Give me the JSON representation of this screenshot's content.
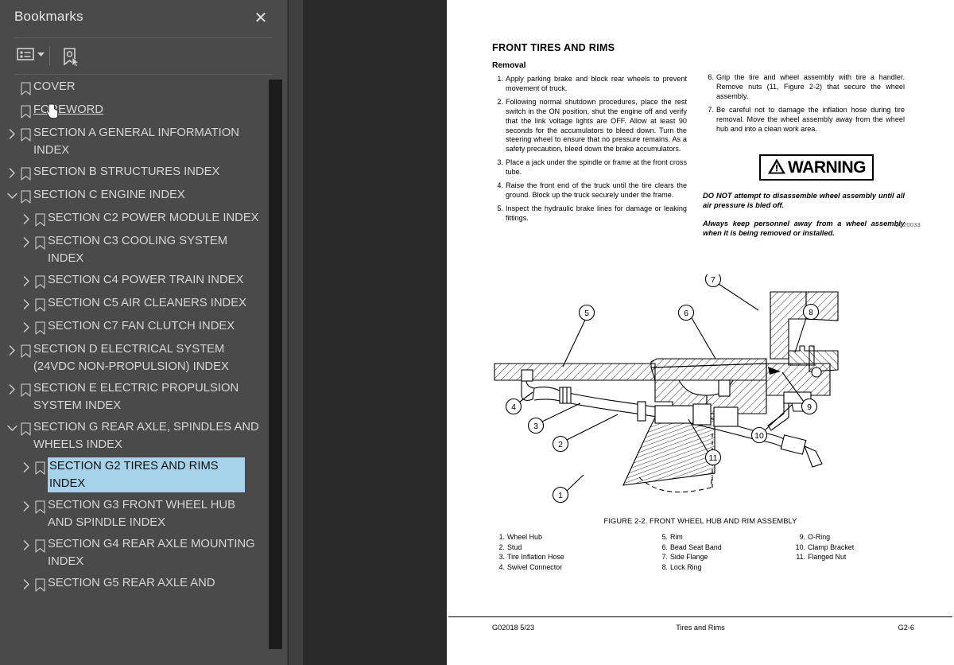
{
  "panel": {
    "title": "Bookmarks",
    "close_icon": "close-icon",
    "toolbar": {
      "options_icon": "list-options-icon",
      "options_caret_icon": "chevron-down-icon",
      "add_bookmark_icon": "add-bookmark-icon"
    },
    "items": [
      {
        "label": "COVER",
        "level": 0,
        "state": "leaf",
        "selected": false,
        "hovered": false
      },
      {
        "label": "FOREWORD",
        "level": 0,
        "state": "leaf",
        "selected": false,
        "hovered": true
      },
      {
        "label": "SECTION A GENERAL INFORMATION INDEX",
        "level": 0,
        "state": "collapsed",
        "selected": false,
        "hovered": false
      },
      {
        "label": "SECTION B STRUCTURES INDEX",
        "level": 0,
        "state": "collapsed",
        "selected": false,
        "hovered": false
      },
      {
        "label": "SECTION C ENGINE INDEX",
        "level": 0,
        "state": "expanded",
        "selected": false,
        "hovered": false
      },
      {
        "label": "SECTION C2 POWER MODULE INDEX",
        "level": 1,
        "state": "collapsed",
        "selected": false,
        "hovered": false
      },
      {
        "label": "SECTION C3 COOLING SYSTEM INDEX",
        "level": 1,
        "state": "collapsed",
        "selected": false,
        "hovered": false
      },
      {
        "label": "SECTION C4 POWER TRAIN INDEX",
        "level": 1,
        "state": "collapsed",
        "selected": false,
        "hovered": false
      },
      {
        "label": "SECTION C5 AIR CLEANERS INDEX",
        "level": 1,
        "state": "collapsed",
        "selected": false,
        "hovered": false
      },
      {
        "label": "SECTION C7 FAN CLUTCH INDEX",
        "level": 1,
        "state": "collapsed",
        "selected": false,
        "hovered": false
      },
      {
        "label": "SECTION D ELECTRICAL SYSTEM (24VDC NON-PROPULSION) INDEX",
        "level": 0,
        "state": "collapsed",
        "selected": false,
        "hovered": false
      },
      {
        "label": "SECTION E ELECTRIC PROPULSION SYSTEM INDEX",
        "level": 0,
        "state": "collapsed",
        "selected": false,
        "hovered": false
      },
      {
        "label": "SECTION G REAR AXLE, SPINDLES AND WHEELS INDEX",
        "level": 0,
        "state": "expanded",
        "selected": false,
        "hovered": false
      },
      {
        "label": "SECTION G2 TIRES AND RIMS INDEX",
        "level": 1,
        "state": "collapsed",
        "selected": true,
        "hovered": false
      },
      {
        "label": "SECTION G3 FRONT WHEEL HUB AND SPINDLE INDEX",
        "level": 1,
        "state": "collapsed",
        "selected": false,
        "hovered": false
      },
      {
        "label": "SECTION G4 REAR AXLE MOUNTING INDEX",
        "level": 1,
        "state": "collapsed",
        "selected": false,
        "hovered": false
      },
      {
        "label": "SECTION G5 REAR AXLE AND",
        "level": 1,
        "state": "collapsed",
        "selected": false,
        "hovered": false
      }
    ],
    "collapse_handle_icon": "collapse-panel-arrow-icon"
  },
  "document": {
    "title": "FRONT TIRES AND RIMS",
    "subtitle": "Removal",
    "steps_left": [
      {
        "n": "1.",
        "text": "Apply parking brake and block rear wheels to prevent movement of truck."
      },
      {
        "n": "2.",
        "text": "Following normal shutdown procedures, place the rest switch in the ON position, shut the engine off and verify that the link voltage lights are OFF. Allow at least 90 seconds for the accumulators to bleed down. Turn the steering wheel to ensure that no pressure remains. As a safety precaution, bleed down the brake accumulators."
      },
      {
        "n": "3.",
        "text": "Place a jack under the spindle or frame at the front cross tube."
      },
      {
        "n": "4.",
        "text": "Raise the front end of the truck until the tire clears the ground. Block up the truck securely under the frame."
      },
      {
        "n": "5.",
        "text": "Inspect the hydraulic brake lines for damage or leaking fittings."
      }
    ],
    "steps_right": [
      {
        "n": "6.",
        "text": "Grip the tire and wheel assembly with tire a handler. Remove nuts (11, Figure 2-2) that secure the wheel assembly."
      },
      {
        "n": "7.",
        "text": "Be careful not to damage the inflation hose during tire removal. Move the wheel assembly away from the wheel hub and into a clean work area."
      }
    ],
    "warning": {
      "icon": "warning-triangle-icon",
      "label": "WARNING",
      "paragraphs": [
        "DO NOT attempt to disassemble wheel assembly until all air pressure is bled off.",
        "Always keep personnel away from a wheel assembly when it is being removed or installed."
      ]
    },
    "figure": {
      "drawing_number": "G020033",
      "caption": "FIGURE 2-2. FRONT WHEEL HUB AND RIM ASSEMBLY",
      "callouts": [
        "1",
        "2",
        "3",
        "4",
        "5",
        "6",
        "7",
        "8",
        "9",
        "10",
        "11"
      ],
      "parts_col1": [
        {
          "n": "1.",
          "name": "Wheel Hub"
        },
        {
          "n": "2.",
          "name": "Stud"
        },
        {
          "n": "3.",
          "name": "Tire Inflation Hose"
        },
        {
          "n": "4.",
          "name": "Swivel Connector"
        }
      ],
      "parts_col2": [
        {
          "n": "5.",
          "name": "Rim"
        },
        {
          "n": "6.",
          "name": "Bead Seat Band"
        },
        {
          "n": "7.",
          "name": "Side Flange"
        },
        {
          "n": "8.",
          "name": "Lock Ring"
        }
      ],
      "parts_col3": [
        {
          "n": "9.",
          "name": "O-Ring"
        },
        {
          "n": "10.",
          "name": "Clamp Bracket"
        },
        {
          "n": "11.",
          "name": "Flanged Nut"
        }
      ]
    },
    "footer": {
      "left": "G02018   5/23",
      "center": "Tires and Rims",
      "right": "G2-6"
    }
  },
  "colors": {
    "panel_bg": "#4a4a4a",
    "viewer_bg": "#2a2a2a",
    "selection": "#a6d2ea",
    "page": "#ffffff"
  }
}
